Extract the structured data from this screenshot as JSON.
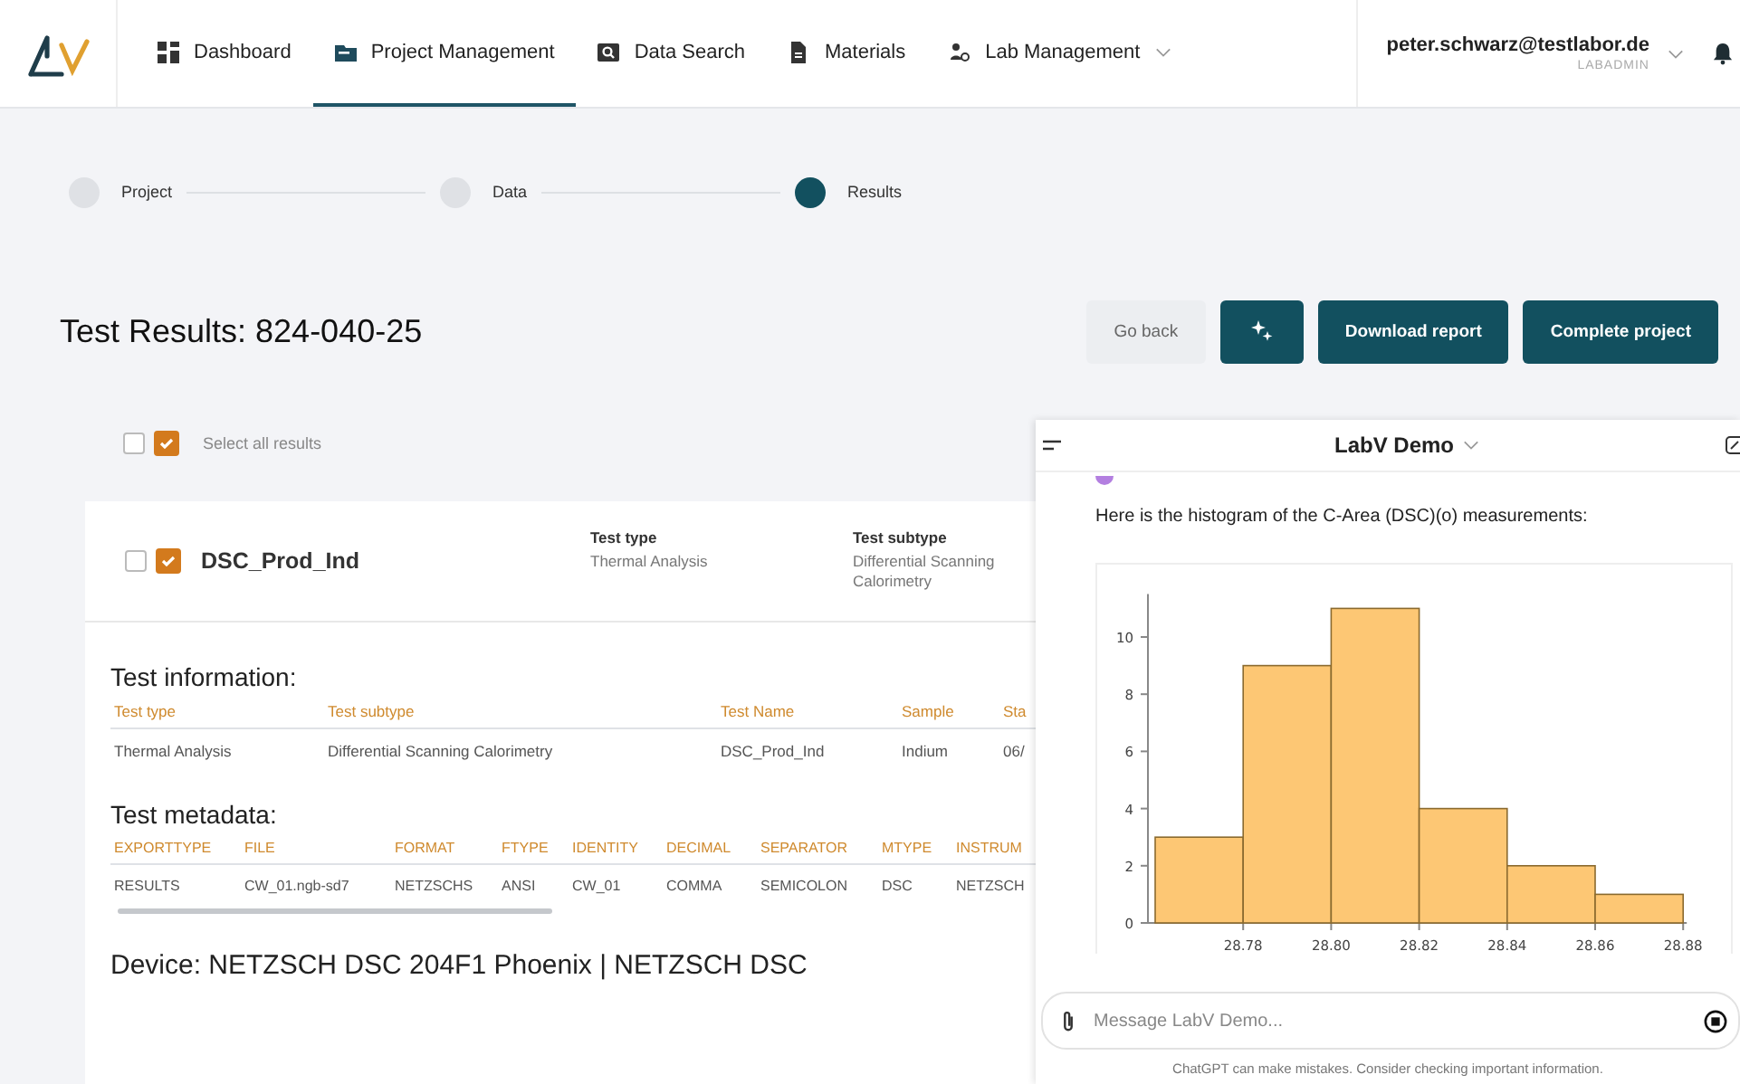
{
  "nav": {
    "items": [
      {
        "label": "Dashboard",
        "selected": false,
        "dropdown": false
      },
      {
        "label": "Project Management",
        "selected": true,
        "dropdown": false
      },
      {
        "label": "Data Search",
        "selected": false,
        "dropdown": false
      },
      {
        "label": "Materials",
        "selected": false,
        "dropdown": false
      },
      {
        "label": "Lab Management",
        "selected": false,
        "dropdown": true
      }
    ],
    "user": {
      "email": "peter.schwarz@testlabor.de",
      "role": "LABADMIN"
    }
  },
  "stepper": [
    {
      "label": "Project",
      "selected": false
    },
    {
      "label": "Data",
      "selected": false
    },
    {
      "label": "Results",
      "selected": true
    }
  ],
  "title": "Test Results: 824-040-25",
  "actions": {
    "back": "Go back",
    "buttons": [
      "Download report",
      "Complete project"
    ]
  },
  "select_all": {
    "label": "Select all results",
    "checkboxes": [
      {
        "checked": false
      },
      {
        "checked": true
      }
    ]
  },
  "result": {
    "name": "DSC_Prod_Ind",
    "checkboxes": [
      {
        "checked": false
      },
      {
        "checked": true
      }
    ],
    "fields": [
      {
        "label": "Test type",
        "value": "Thermal Analysis"
      },
      {
        "label": "Test subtype",
        "value": "Differential Scanning Calorimetry"
      }
    ],
    "info": {
      "title": "Test information:",
      "columns": [
        "Test type",
        "Test subtype",
        "Test Name",
        "Sample",
        "Sta"
      ],
      "rows": [
        [
          "Thermal Analysis",
          "Differential Scanning Calorimetry",
          "DSC_Prod_Ind",
          "Indium",
          "06/"
        ]
      ]
    },
    "metadata": {
      "title": "Test metadata:",
      "columns": [
        "EXPORTTYPE",
        "FILE",
        "FORMAT",
        "FTYPE",
        "IDENTITY",
        "DECIMAL",
        "SEPARATOR",
        "MTYPE",
        "INSTRUM"
      ],
      "rows": [
        [
          "RESULTS",
          "CW_01.ngb-sd7",
          "NETZSCHS",
          "ANSI",
          "CW_01",
          "COMMA",
          "SEMICOLON",
          "DSC",
          "NETZSCH"
        ]
      ]
    },
    "device": "Device: NETZSCH DSC 204F1 Phoenix | NETZSCH DSC"
  },
  "chat": {
    "title": "LabV Demo",
    "message": "Here is the histogram of the C-Area (DSC)(o) measurements:",
    "chart_data": {
      "type": "bar",
      "x": [
        28.77,
        28.79,
        28.81,
        28.83,
        28.85,
        28.87
      ],
      "values": [
        3,
        9,
        11,
        4,
        2,
        1
      ],
      "xlim": [
        28.76,
        28.88
      ],
      "ylim": [
        0,
        11.5
      ],
      "xticks": [
        {
          "value": 28.78,
          "label": "28.78"
        },
        {
          "value": 28.8,
          "label": "28.80"
        },
        {
          "value": 28.82,
          "label": "28.82"
        },
        {
          "value": 28.84,
          "label": "28.84"
        },
        {
          "value": 28.86,
          "label": "28.86"
        },
        {
          "value": 28.88,
          "label": "28.88"
        }
      ],
      "yticks": [
        0,
        2,
        4,
        6,
        8,
        10
      ]
    },
    "input": {
      "placeholder": "Message LabV Demo..."
    },
    "disclaimer": "ChatGPT can make mistakes. Consider checking important information."
  }
}
